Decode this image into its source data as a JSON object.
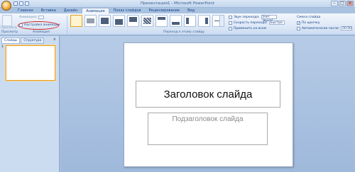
{
  "app": {
    "title": "Презентация1 - Microsoft PowerPoint"
  },
  "tabs": [
    {
      "label": "Главная"
    },
    {
      "label": "Вставка"
    },
    {
      "label": "Дизайн"
    },
    {
      "label": "Анимация"
    },
    {
      "label": "Показ слайдов"
    },
    {
      "label": "Рецензирование"
    },
    {
      "label": "Вид"
    }
  ],
  "ribbon": {
    "preview_label": "Просмотр",
    "preview_group": "Просмотр",
    "anim_label": "Анимация:",
    "custom_anim": "Настройка анимации",
    "anim_group": "Анимация",
    "transitions_group": "Переход к этому слайду",
    "sound_label": "Звук перехода:",
    "sound_value": "[Нет звука]",
    "speed_label": "Скорость перехода:",
    "speed_value": "Быстро",
    "apply_all": "Применить ко всем",
    "advance_label": "Смена слайда",
    "on_click": "По щелчку",
    "auto_after": "Автоматически после:",
    "auto_time": "00:00"
  },
  "left_pane": {
    "tab_slides": "Слайды",
    "tab_outline": "Структура",
    "close": "×",
    "slide_number": "1"
  },
  "slide": {
    "title": "Заголовок слайда",
    "subtitle": "Подзаголовок слайда"
  }
}
